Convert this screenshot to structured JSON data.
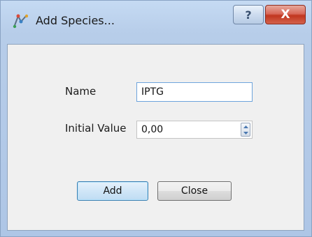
{
  "window": {
    "title": "Add Species...",
    "help_label": "?",
    "close_label": "X"
  },
  "form": {
    "name_label": "Name",
    "name_value": "IPTG",
    "initial_value_label": "Initial Value",
    "initial_value": "0,00"
  },
  "buttons": {
    "add_label": "Add",
    "close_label": "Close"
  }
}
